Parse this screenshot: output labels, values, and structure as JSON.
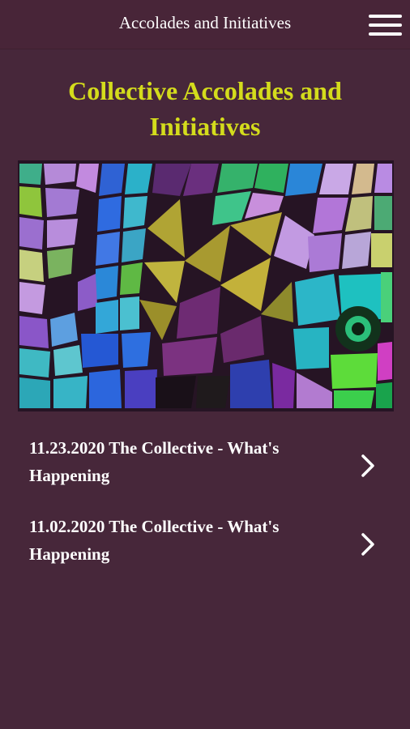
{
  "header": {
    "title": "Accolades and Initiatives",
    "menu_icon": "hamburger-menu-icon"
  },
  "main": {
    "heading": "Collective Accolades and Initiatives",
    "hero_image": "stained-glass-mosaic-image",
    "items": [
      {
        "label": "11.23.2020 The Collective - What's Happening",
        "icon": "chevron-right-icon"
      },
      {
        "label": "11.02.2020 The Collective - What's Happening",
        "icon": "chevron-right-icon"
      }
    ]
  },
  "colors": {
    "background": "#47273a",
    "header_background": "#482538",
    "heading": "#d4dc1c",
    "text": "#ffffff"
  }
}
